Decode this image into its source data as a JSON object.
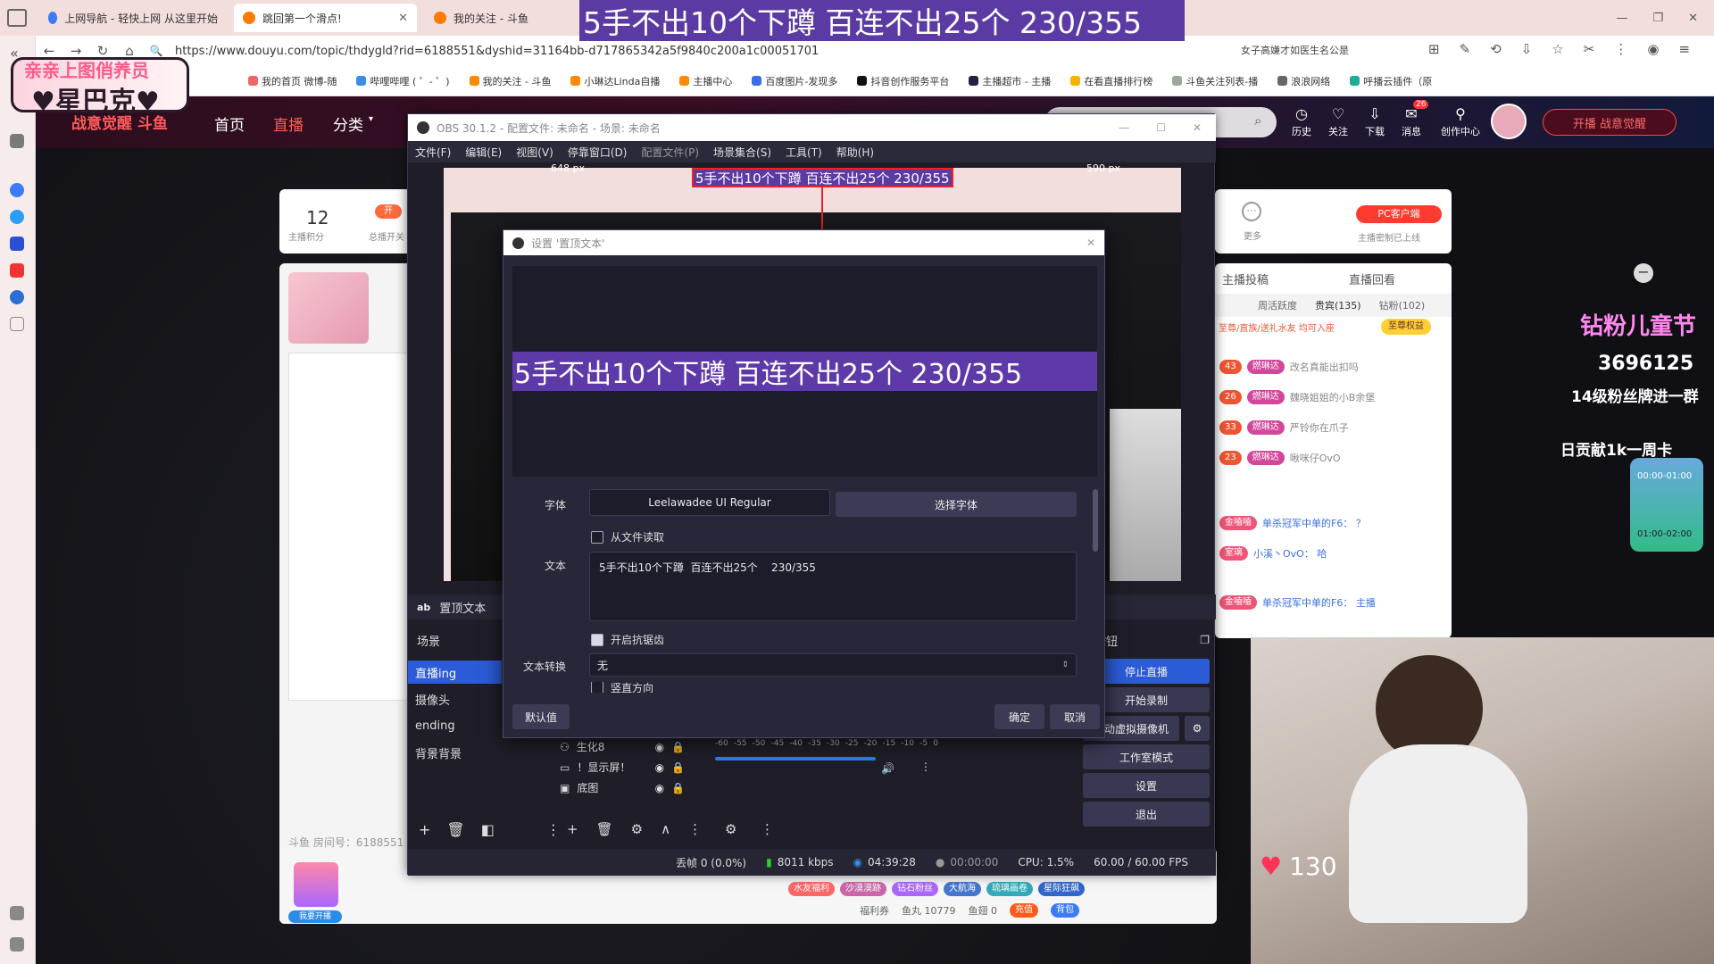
{
  "browser": {
    "tabs": [
      {
        "label": "上网导航 - 轻快上网 从这里开始"
      },
      {
        "label": "跳回第一个滑点!"
      },
      {
        "label": "我的关注 - 斗鱼"
      }
    ],
    "url": "https://www.douyu.com/topic/thdygld?rid=6188551&dyshid=31164bb-d717865342a5f9840c200a1c00051701",
    "search_hint": "女子高嫌才如医生名公是",
    "bookmarks": [
      "我的首页 微博-随",
      "哔哩哔哩 ( ゜- ゜)",
      "我的关注 - 斗鱼",
      "小琳达Linda自播",
      "主播中心",
      "百度图片-发现多",
      "抖音创作服务平台",
      "主播超市 - 主播",
      "在看直播排行榜",
      "斗鱼关注列表-播",
      "浪浪网络",
      "呼播云插件（原"
    ]
  },
  "overlay": {
    "top_text": "5手不出10个下蹲  百连不出25个    230/355",
    "logo_line1": "亲亲上图俏养员",
    "logo_line2": "♥星巴克♥"
  },
  "site": {
    "nav": [
      "首页",
      "直播",
      "分类"
    ],
    "header_icons": [
      {
        "icon": "history-icon",
        "label": "历史"
      },
      {
        "icon": "follow-icon",
        "label": "关注"
      },
      {
        "icon": "download-icon",
        "label": "下载"
      },
      {
        "icon": "message-icon",
        "label": "消息",
        "badge": "26"
      },
      {
        "icon": "creator-icon",
        "label": "创作中心"
      }
    ],
    "top_card": {
      "points": "12",
      "points_label": "主播积分",
      "open_label": "开",
      "open_sub": "总播开关",
      "more_label": "更多",
      "pc_button": "PC客户端",
      "pc_sub": "主播密制已上线"
    },
    "room_id": "斗鱼 房间号：6188551",
    "panel_tabs": [
      "主播投稿",
      "直播回看"
    ],
    "rank_tabs": [
      "周活跃度",
      "贵宾(135)",
      "钻粉(102)"
    ],
    "rank_notice": "至尊/直族/送礼水友 均可入座",
    "rank_button": "至尊权益",
    "chat": [
      {
        "level": "43",
        "badge": "燃琳达",
        "text": "改名真能出扣吗"
      },
      {
        "level": "26",
        "badge": "燃琳达",
        "text": "魏晓姐姐的小B余堡"
      },
      {
        "level": "33",
        "badge": "燃琳达",
        "text": "严铃你在爪子"
      },
      {
        "level": "23",
        "badge": "燃琳达",
        "text": "啾咪仔OvO"
      },
      {
        "level": "",
        "badge": "金嗑嗑",
        "text": "单杀冠军中单的F6： ？"
      },
      {
        "level": "",
        "badge": "室璃",
        "text": "小溪丶OvO： 哈"
      },
      {
        "level": "",
        "badge": "金嗑嗑",
        "text": "单杀冠军中单的F6： 主播"
      }
    ],
    "gift_bar": [
      "我要开播",
      "水友福利",
      "沙漠漠跡",
      "钻石粉丝",
      "大航海",
      "琉璃画卷",
      "星际狂飙"
    ],
    "wallet": {
      "coins_label": "福利券",
      "yuwan": "鱼丸 10779",
      "yuchi": "鱼翅 0",
      "recharge": "充值",
      "bag": "背包"
    },
    "promo_number": "3696125",
    "promo_line1": "14级粉丝牌进一群",
    "promo_line2": "日贡献1k一周卡",
    "promo_timer1": "00:00-01:00",
    "promo_timer2": "01:00-02:00",
    "heart_count": "130"
  },
  "obs": {
    "title": "OBS 30.1.2 - 配置文件: 未命名 - 场景: 未命名",
    "menu": [
      "文件(F)",
      "编辑(E)",
      "视图(V)",
      "停靠窗口(D)",
      "配置文件(P)",
      "场景集合(S)",
      "工具(T)",
      "帮助(H)"
    ],
    "preview_left_px": "648 px",
    "preview_right_px": "590 px",
    "source_bar_label": "置顶文本",
    "scenes_header": "场景",
    "scenes": [
      "直播ing",
      "摄像头",
      "ending",
      "背景背景"
    ],
    "sources": [
      "生化8",
      "！显示屏！",
      "底图"
    ],
    "mixer_scale": [
      "-60",
      "-55",
      "-50",
      "-45",
      "-40",
      "-35",
      "-30",
      "-25",
      "-20",
      "-15",
      "-10",
      "-5",
      "0"
    ],
    "controls_header": "制按钮",
    "controls": [
      "停止直播",
      "开始录制",
      "启动虚拟摄像机",
      "工作室模式",
      "设置",
      "退出"
    ],
    "status": {
      "dropped": "丢帧 0 (0.0%)",
      "bitrate": "8011 kbps",
      "live_time": "04:39:28",
      "rec_time": "00:00:00",
      "cpu": "CPU: 1.5%",
      "fps": "60.00 / 60.00 FPS"
    }
  },
  "dialog": {
    "title": "设置 '置顶文本'",
    "preview_text": "5手不出10个下蹲  百连不出25个    230/355",
    "font_label": "字体",
    "font_value": "Leelawadee UI Regular",
    "font_button": "选择字体",
    "from_file_label": "从文件读取",
    "text_label": "文本",
    "text_value": "5手不出10个下蹲  百连不出25个    230/355",
    "antialias_label": "开启抗锯齿",
    "transform_label": "文本转换",
    "transform_value": "无",
    "vertical_label": "竖直方向",
    "defaults_button": "默认值",
    "ok_button": "确定",
    "cancel_button": "取消"
  },
  "colors": {
    "accent_purple": "#5b3aa3",
    "obs_bg": "#1f1e28",
    "douyu_orange": "#ff6a3d",
    "obs_blue": "#2b5bd6"
  }
}
